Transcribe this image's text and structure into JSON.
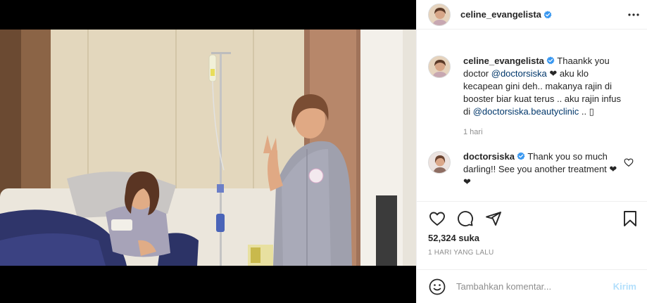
{
  "header": {
    "username": "celine_evangelista",
    "verified_icon": "verified-badge-icon",
    "more_icon": "more-options-icon"
  },
  "caption": {
    "username": "celine_evangelista",
    "text_1": " Thaankk you doctor ",
    "mention_1": "@doctorsiska",
    "text_2": " ❤ aku klo kecapean gini deh.. makanya rajin di booster biar kuat terus .. aku rajin infus di ",
    "mention_2": "@doctorsiska.beautyclinic",
    "text_3": " .. ▯",
    "age": "1 hari"
  },
  "reply": {
    "username": "doctorsiska",
    "text": " Thank you so much darling!! See you another treatment ❤❤"
  },
  "actions": {
    "like_icon": "heart-icon",
    "comment_icon": "comment-icon",
    "share_icon": "share-icon",
    "save_icon": "bookmark-icon"
  },
  "likes": {
    "count": "52,324",
    "unit": " suka"
  },
  "timestamp": "1 HARI YANG LALU",
  "add_comment": {
    "emoji_icon": "emoji-icon",
    "placeholder": "Tambahkan komentar...",
    "post_label": "Kirim"
  },
  "colors": {
    "verified": "#3897f0",
    "mention": "#00376b",
    "muted": "#8e8e8e",
    "post_disabled": "#b2dffc",
    "border": "#efefef"
  }
}
